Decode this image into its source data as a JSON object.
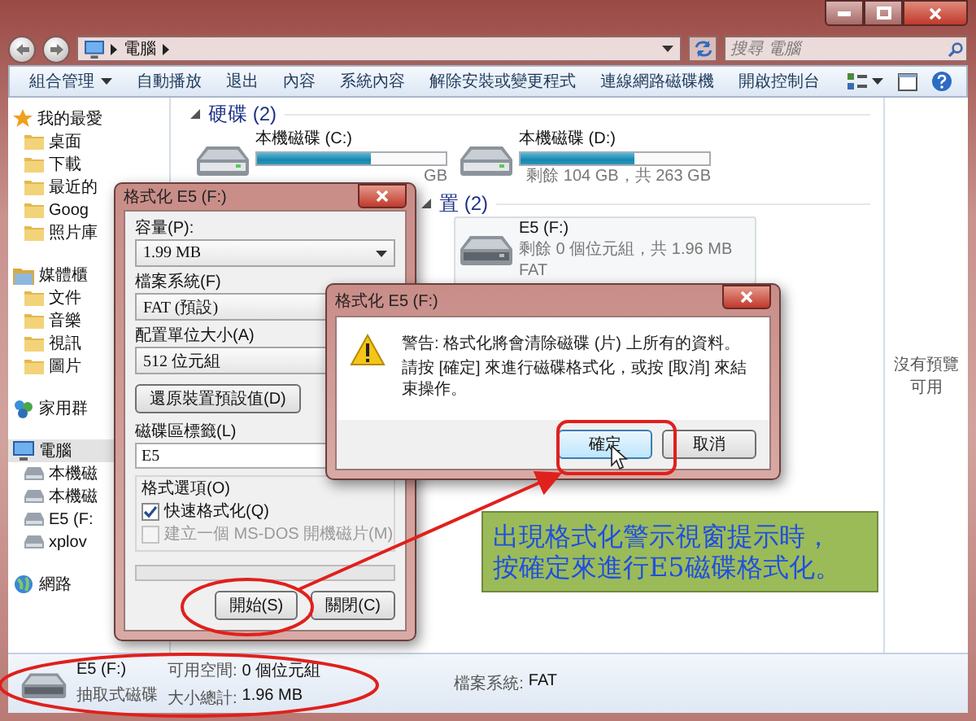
{
  "address_bar": {
    "path": [
      "電腦"
    ]
  },
  "search": {
    "placeholder": "搜尋 電腦"
  },
  "toolbar": {
    "items": [
      {
        "label": "組合管理",
        "has_menu": true
      },
      {
        "label": "自動播放",
        "has_menu": false
      },
      {
        "label": "退出",
        "has_menu": false
      },
      {
        "label": "內容",
        "has_menu": false
      },
      {
        "label": "系統內容",
        "has_menu": false
      },
      {
        "label": "解除安裝或變更程式",
        "has_menu": false
      },
      {
        "label": "連線網路磁碟機",
        "has_menu": false
      },
      {
        "label": "開啟控制台",
        "has_menu": false
      }
    ]
  },
  "sidebar": {
    "groups": [
      {
        "label": "我的最愛",
        "selected": false,
        "children": [
          {
            "label": "桌面",
            "selected": false
          },
          {
            "label": "下載",
            "selected": false
          },
          {
            "label": "最近的",
            "selected": false
          },
          {
            "label": "Goog",
            "selected": false
          },
          {
            "label": "照片庫",
            "selected": false
          }
        ]
      },
      {
        "label": "媒體櫃",
        "selected": false,
        "children": [
          {
            "label": "文件",
            "selected": false
          },
          {
            "label": "音樂",
            "selected": false
          },
          {
            "label": "視訊",
            "selected": false
          },
          {
            "label": "圖片",
            "selected": false
          }
        ]
      },
      {
        "label": "家用群",
        "selected": false
      },
      {
        "label": "電腦",
        "selected": true,
        "children": [
          {
            "label": "本機磁",
            "selected": false
          },
          {
            "label": "本機磁",
            "selected": false
          },
          {
            "label": "E5 (F:",
            "selected": false
          },
          {
            "label": "xplov",
            "selected": false
          }
        ]
      },
      {
        "label": "網路",
        "selected": false
      }
    ]
  },
  "content": {
    "groups": [
      {
        "header": "硬碟 (2)",
        "expanded": true,
        "items": [
          {
            "kind": "hdd",
            "label": "本機磁碟 (C:)",
            "level": 0.6,
            "details": [
              "GB"
            ],
            "selected": false
          },
          {
            "kind": "hdd",
            "label": "本機磁碟 (D:)",
            "level": 0.6,
            "details": [
              "剩餘 104 GB，共 263 GB"
            ],
            "selected": false
          }
        ]
      },
      {
        "header": "置 (2)",
        "expanded": true,
        "items": [
          {
            "kind": "removable",
            "label": "E5 (F:)",
            "details": [
              "剩餘 0 個位元組，共 1.96 MB",
              "FAT"
            ],
            "selected": true
          }
        ]
      }
    ]
  },
  "preview_pane": {
    "message": "沒有預覽可用"
  },
  "status_bar": {
    "name": "E5 (F:)",
    "type": "抽取式磁碟",
    "fields": [
      {
        "label": "可用空間:",
        "value": "0 個位元組"
      },
      {
        "label": "大小總計:",
        "value": "1.96 MB"
      },
      {
        "label": "檔案系統:",
        "value": "FAT"
      }
    ]
  },
  "format_dialog": {
    "title": "格式化 E5 (F:)",
    "fields": [
      {
        "label": "容量(P):",
        "value": "1.99 MB"
      },
      {
        "label": "檔案系統(F)",
        "value": "FAT (預設)"
      },
      {
        "label": "配置單位大小(A)",
        "value": "512 位元組"
      }
    ],
    "restore_button": "還原裝置預設值(D)",
    "volume_label": {
      "label": "磁碟區標籤(L)",
      "value": "E5"
    },
    "options": {
      "title": "格式選項(O)",
      "checkboxes": [
        {
          "label": "快速格式化(Q)",
          "checked": true,
          "disabled": false
        },
        {
          "label": "建立一個 MS-DOS 開機磁片(M)",
          "checked": false,
          "disabled": true
        }
      ]
    },
    "progress": {
      "level": 0
    },
    "buttons": [
      "開始(S)",
      "關閉(C)"
    ]
  },
  "warning_dialog": {
    "title": "格式化 E5 (F:)",
    "lines": [
      "警告: 格式化將會清除磁碟 (片) 上所有的資料。",
      "請按 [確定] 來進行磁碟格式化，或按 [取消] 來結束操作。"
    ],
    "buttons": [
      {
        "label": "確定",
        "focused": true
      },
      {
        "label": "取消",
        "focused": false
      }
    ]
  },
  "callout": {
    "lines": [
      "出現格式化警示視窗提示時，",
      "按確定來進行E5磁碟格式化。"
    ]
  }
}
